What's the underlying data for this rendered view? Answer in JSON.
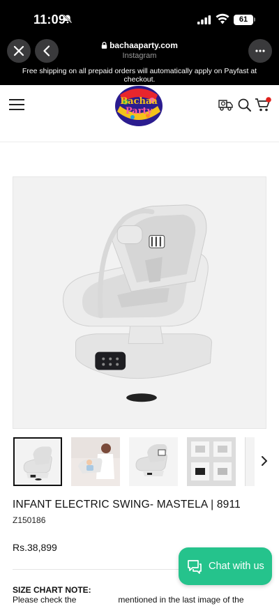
{
  "status_bar": {
    "time": "11:09",
    "battery": "61"
  },
  "browser": {
    "domain": "bachaaparty.com",
    "source": "Instagram"
  },
  "announcement": "Free shipping on all prepaid orders will automatically apply on Payfast at checkout.",
  "logo_text": "BachaaParty",
  "product": {
    "title": "INFANT ELECTRIC SWING- MASTELA | 8911",
    "sku": "Z150186",
    "price": "Rs.38,899"
  },
  "size_chart": {
    "title": "SIZE CHART NOTE:",
    "text_start": "Please check the",
    "text_end": "mentioned in the last image of the"
  },
  "chat": {
    "label": "Chat with us"
  },
  "colors": {
    "chat_green": "#25c38c",
    "cart_badge": "#e0201b"
  }
}
